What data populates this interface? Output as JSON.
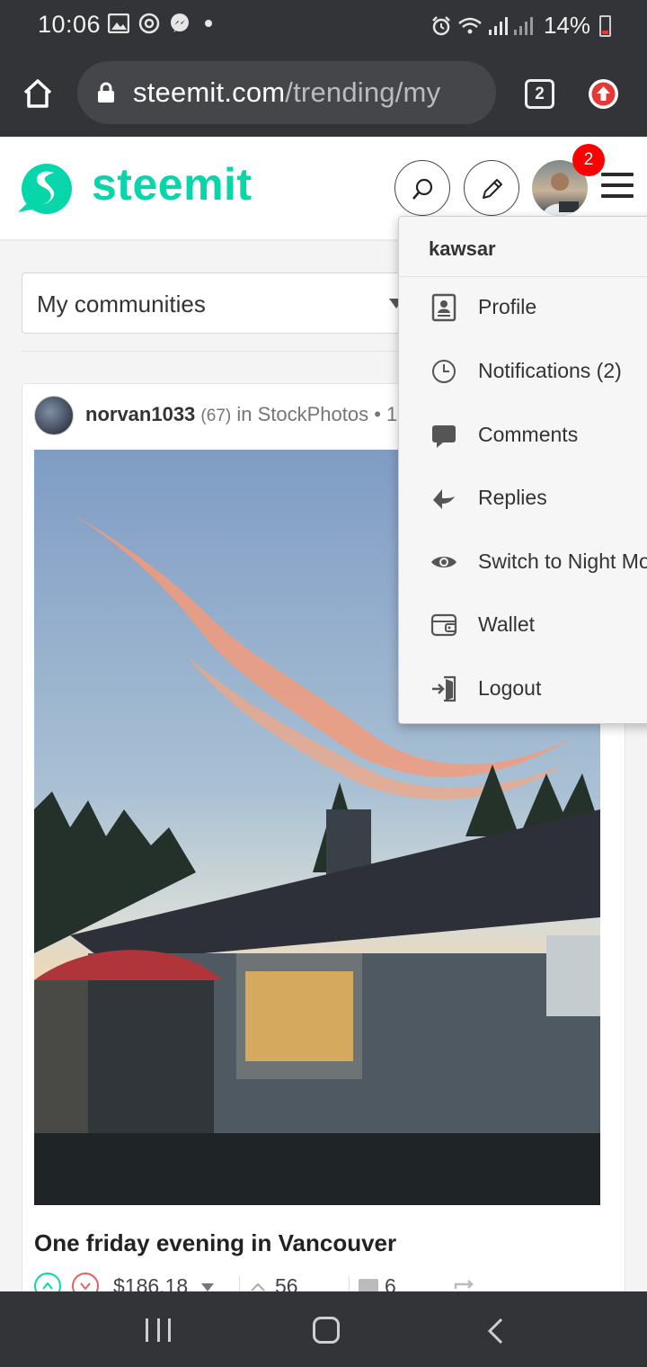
{
  "status_bar": {
    "time": "10:06",
    "battery_text": "14%",
    "left_icons": [
      "gallery-icon",
      "instagram-icon",
      "messenger-icon",
      "dot-icon"
    ],
    "right_icons": [
      "alarm-icon",
      "wifi-icon",
      "signal-icon",
      "signal-icon",
      "battery-icon"
    ]
  },
  "browser": {
    "url_host": "steemit.com",
    "url_path": "/trending/my",
    "tab_count": "2"
  },
  "header": {
    "brand": "steemit",
    "notification_badge": "2",
    "brand_color": "#06d6a9"
  },
  "filter": {
    "selected": "My communities"
  },
  "post": {
    "author": "norvan1033",
    "reputation": "(67)",
    "community_prefix": "in",
    "community": "StockPhotos",
    "meta_suffix": "• 1",
    "title": "One friday evening in Vancouver",
    "payout": "$186.18",
    "votes": "56",
    "comments": "6"
  },
  "user_menu": {
    "username": "kawsar",
    "items": [
      {
        "label": "Profile",
        "icon": "profile-icon"
      },
      {
        "label": "Notifications (2)",
        "icon": "clock-icon"
      },
      {
        "label": "Comments",
        "icon": "comment-icon"
      },
      {
        "label": "Replies",
        "icon": "reply-icon"
      },
      {
        "label": "Switch to Night Mo",
        "icon": "eye-icon"
      },
      {
        "label": "Wallet",
        "icon": "wallet-icon"
      },
      {
        "label": "Logout",
        "icon": "logout-icon"
      }
    ]
  }
}
